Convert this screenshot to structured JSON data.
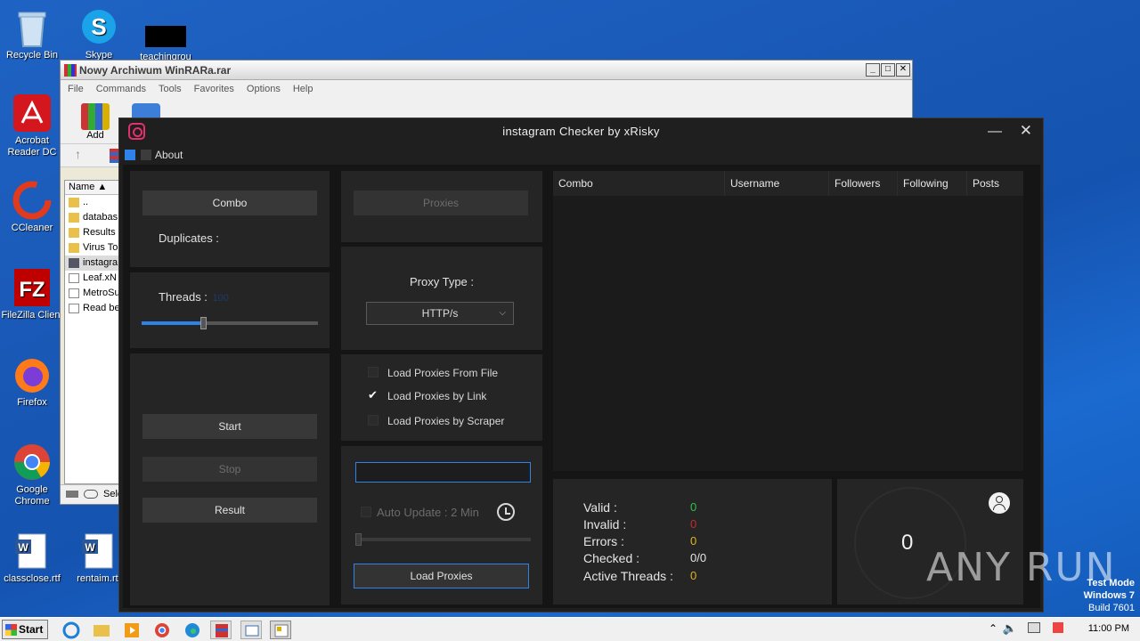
{
  "desktop": {
    "icons": [
      {
        "label": "Recycle Bin"
      },
      {
        "label": "Skype"
      },
      {
        "label": "teachingrou"
      },
      {
        "label": "Acrobat Reader DC"
      },
      {
        "label": "CCleaner"
      },
      {
        "label": "FileZilla Client"
      },
      {
        "label": "Firefox"
      },
      {
        "label": "Google Chrome"
      },
      {
        "label": "classclose.rtf"
      },
      {
        "label": "rentaim.rtf"
      }
    ]
  },
  "winrar": {
    "title": "Nowy Archiwum WinRARa.rar",
    "menu": [
      "File",
      "Commands",
      "Tools",
      "Favorites",
      "Options",
      "Help"
    ],
    "toolbar_add_label": "Add",
    "column_name": "Name",
    "files": [
      "..",
      "databas",
      "Results",
      "Virus To",
      "instagra",
      "Leaf.xN",
      "MetroSu",
      "Read be"
    ],
    "status_text": "Sele"
  },
  "app": {
    "title": "instagram Checker by xRisky",
    "menu_about": "About",
    "combo_button": "Combo",
    "duplicates_label": "Duplicates :",
    "threads_label": "Threads :",
    "threads_value": "100",
    "threads_fraction": 0.35,
    "start_button": "Start",
    "stop_button": "Stop",
    "result_button": "Result",
    "proxies_button": "Proxies",
    "proxy_type_label": "Proxy Type :",
    "proxy_type_value": "HTTP/s",
    "load_from_file": "Load Proxies From File",
    "load_by_link": "Load Proxies by Link",
    "load_by_scraper": "Load Proxies by Scraper",
    "proxy_url_value": "",
    "auto_update_label": "Auto Update : 2 Min",
    "load_proxies_button": "Load Proxies",
    "grid_columns": [
      "Combo",
      "Username",
      "Followers",
      "Following",
      "Posts"
    ],
    "stats": [
      {
        "label": "Valid :",
        "value": "0",
        "color": "#31c14b"
      },
      {
        "label": "Invalid :",
        "value": "0",
        "color": "#c62b2b"
      },
      {
        "label": "Errors :",
        "value": "0",
        "color": "#e3b322"
      },
      {
        "label": "Checked :",
        "value": "0/0",
        "color": "#e6e6e6"
      },
      {
        "label": "Active Threads :",
        "value": "0",
        "color": "#e3b322"
      }
    ],
    "counter": "0"
  },
  "taskbar": {
    "start_label": "Start",
    "clock": "11:00 PM"
  },
  "overlay": {
    "watermark": "ANY RUN",
    "test_mode_line1": "Test Mode",
    "test_mode_line2": "Windows 7",
    "test_mode_line3": "Build 7601"
  }
}
